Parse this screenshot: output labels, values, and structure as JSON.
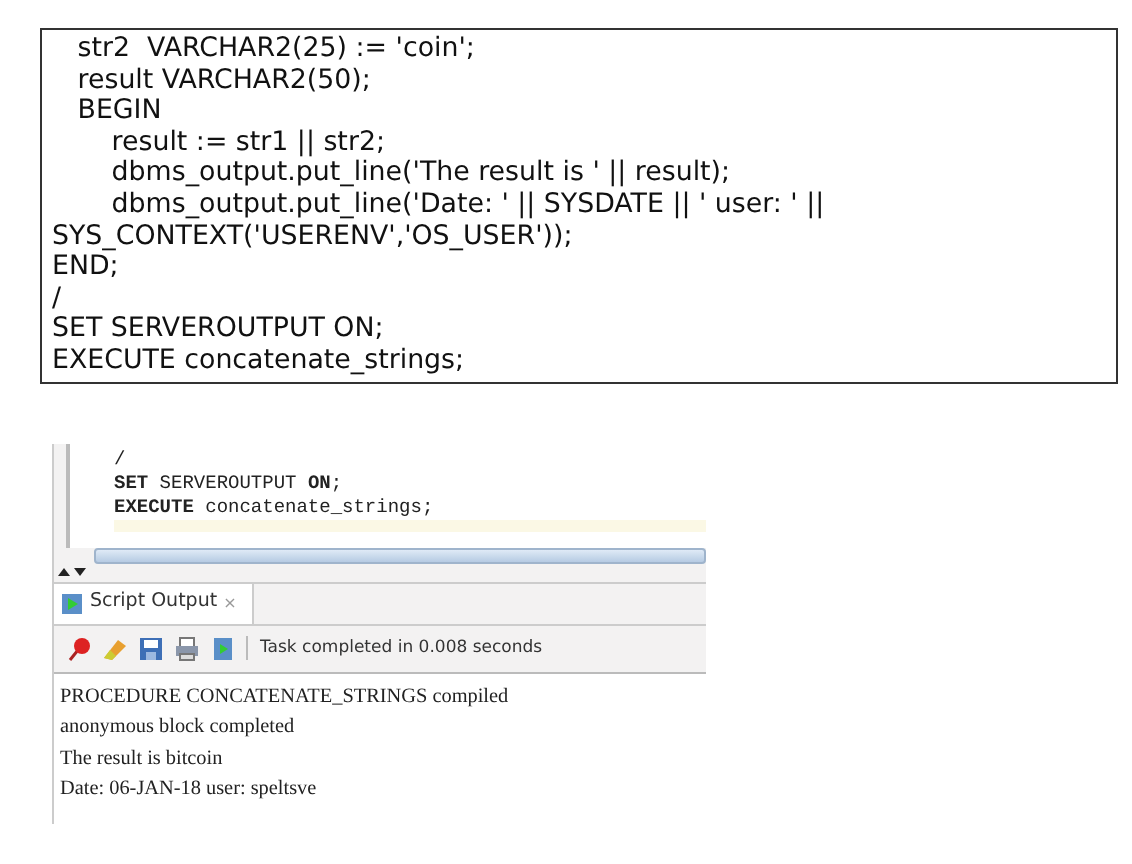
{
  "code_box": {
    "lines": [
      "   str2  VARCHAR2(25) := 'coin';",
      "   result VARCHAR2(50);",
      "   BEGIN",
      "       result := str1 || str2;",
      "       dbms_output.put_line('The result is ' || result);",
      "       dbms_output.put_line('Date: ' || SYSDATE || ' user: ' ||",
      "SYS_CONTEXT('USERENV','OS_USER'));",
      "END;",
      "/",
      "SET SERVEROUTPUT ON;",
      "EXECUTE concatenate_strings;"
    ]
  },
  "screenshot": {
    "editor": {
      "lines": [
        "/",
        "**SET** SERVEROUTPUT **ON**;",
        "**EXECUTE** concatenate_strings;"
      ]
    },
    "tabs": [
      {
        "label": "Script Output",
        "close": "×",
        "selected": true
      }
    ],
    "toolbar": {
      "status": "Task completed in 0.008 seconds"
    },
    "output": {
      "lines": [
        "PROCEDURE CONCATENATE_STRINGS compiled",
        "anonymous block completed",
        "The result is bitcoin",
        "Date: 06-JAN-18 user: speltsve"
      ]
    }
  }
}
